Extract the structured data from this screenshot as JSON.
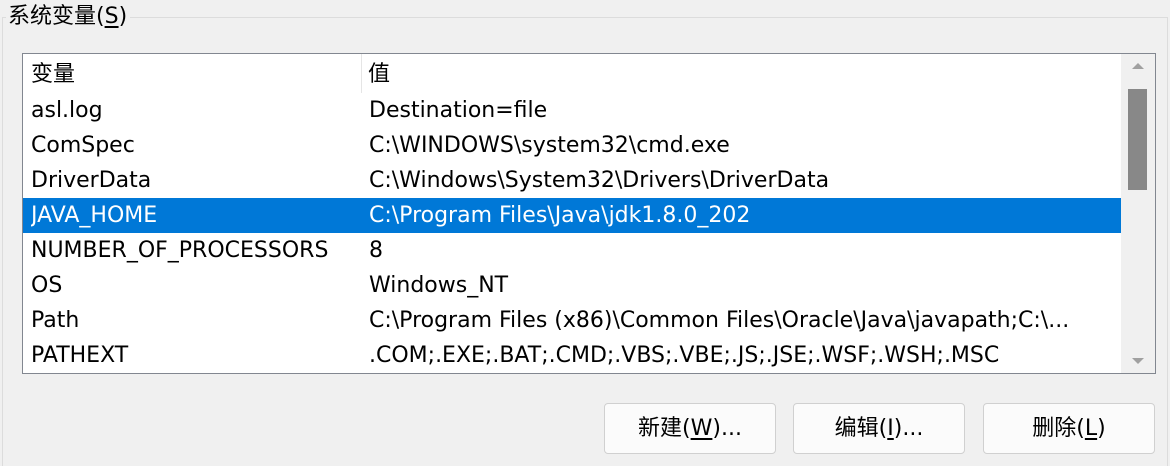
{
  "group": {
    "title_text": "系统变量(",
    "title_key": "S",
    "title_close": ")"
  },
  "table": {
    "headers": [
      "变量",
      "值"
    ],
    "rows": [
      {
        "name": "asl.log",
        "value": "Destination=file",
        "selected": false
      },
      {
        "name": "ComSpec",
        "value": "C:\\WINDOWS\\system32\\cmd.exe",
        "selected": false
      },
      {
        "name": "DriverData",
        "value": "C:\\Windows\\System32\\Drivers\\DriverData",
        "selected": false
      },
      {
        "name": "JAVA_HOME",
        "value": "C:\\Program Files\\Java\\jdk1.8.0_202",
        "selected": true
      },
      {
        "name": "NUMBER_OF_PROCESSORS",
        "value": "8",
        "selected": false
      },
      {
        "name": "OS",
        "value": "Windows_NT",
        "selected": false
      },
      {
        "name": "Path",
        "value": "C:\\Program Files (x86)\\Common Files\\Oracle\\Java\\javapath;C:\\...",
        "selected": false
      },
      {
        "name": "PATHEXT",
        "value": ".COM;.EXE;.BAT;.CMD;.VBS;.VBE;.JS;.JSE;.WSF;.WSH;.MSC",
        "selected": false
      }
    ]
  },
  "buttons": {
    "new": {
      "prefix": "新建(",
      "key": "W",
      "suffix": ")..."
    },
    "edit": {
      "prefix": "编辑(",
      "key": "I",
      "suffix": ")..."
    },
    "delete": {
      "prefix": "删除(",
      "key": "L",
      "suffix": ")"
    }
  },
  "colors": {
    "selection": "#0078d7",
    "scroll_thumb": "#888888"
  }
}
